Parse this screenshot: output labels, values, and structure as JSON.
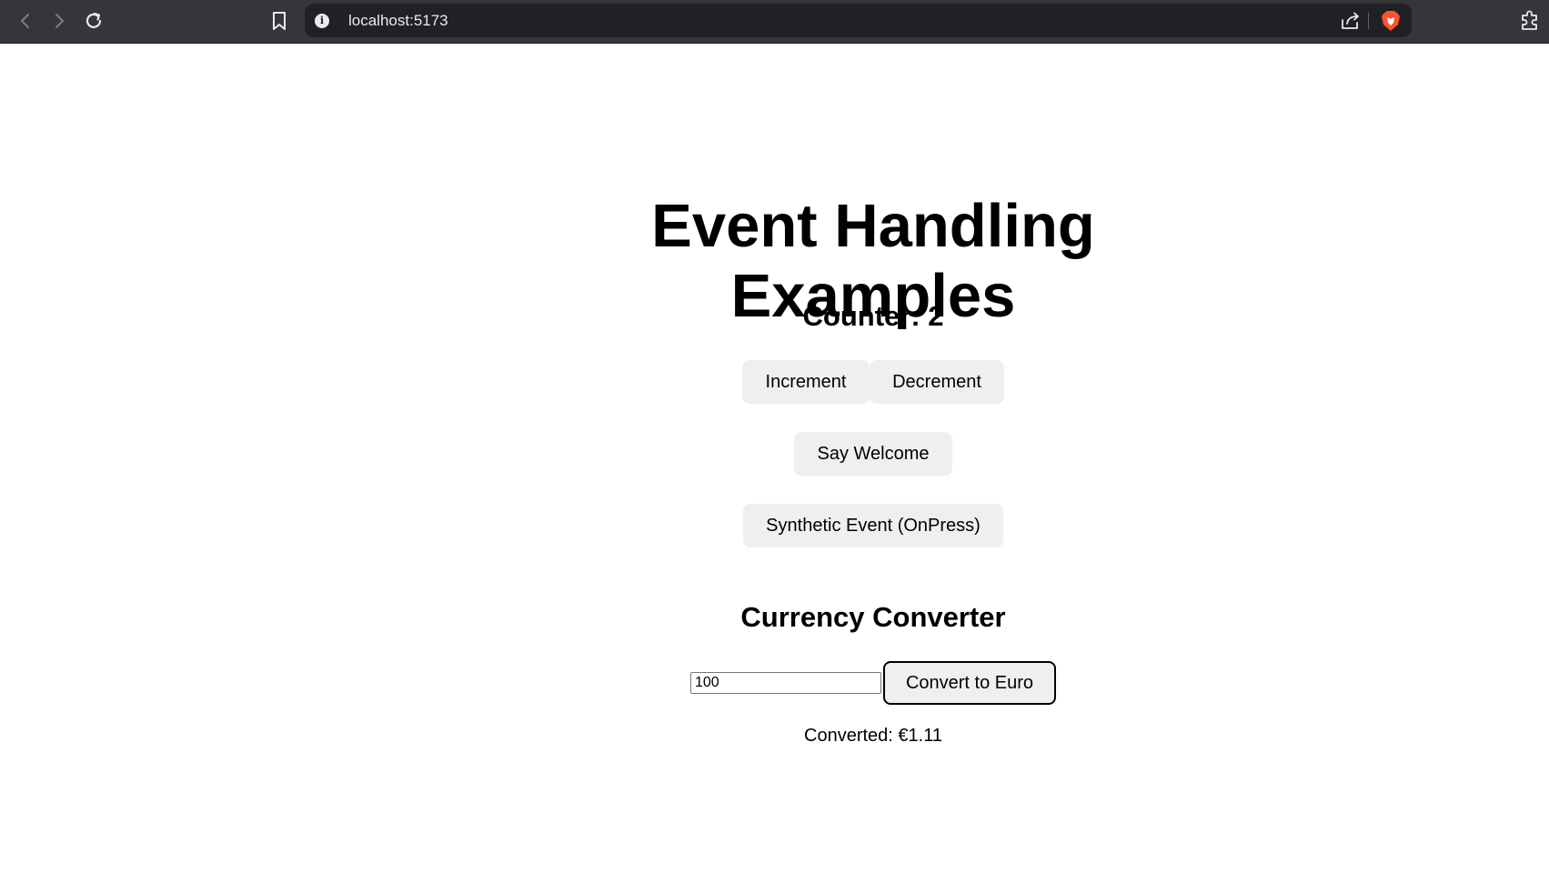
{
  "browser": {
    "url": "localhost:5173",
    "site_info_glyph": "i",
    "icons": [
      "back-icon",
      "forward-icon",
      "reload-icon",
      "bookmark-icon",
      "site-info-icon",
      "share-icon",
      "brave-shield-icon",
      "extensions-icon"
    ]
  },
  "page": {
    "title": "Event Handling Examples",
    "counter_label": "Counter: 2",
    "buttons": {
      "increment": "Increment",
      "decrement": "Decrement",
      "say_welcome": "Say Welcome",
      "synthetic_event": "Synthetic Event (OnPress)"
    },
    "currency": {
      "heading": "Currency Converter",
      "amount_value": "100",
      "convert_label": "Convert to Euro",
      "result": "Converted: €1.11"
    }
  },
  "colors": {
    "chrome_bg": "#35363a",
    "address_bg": "#202124",
    "button_bg": "#efefef",
    "brave_orange": "#fb542b"
  }
}
